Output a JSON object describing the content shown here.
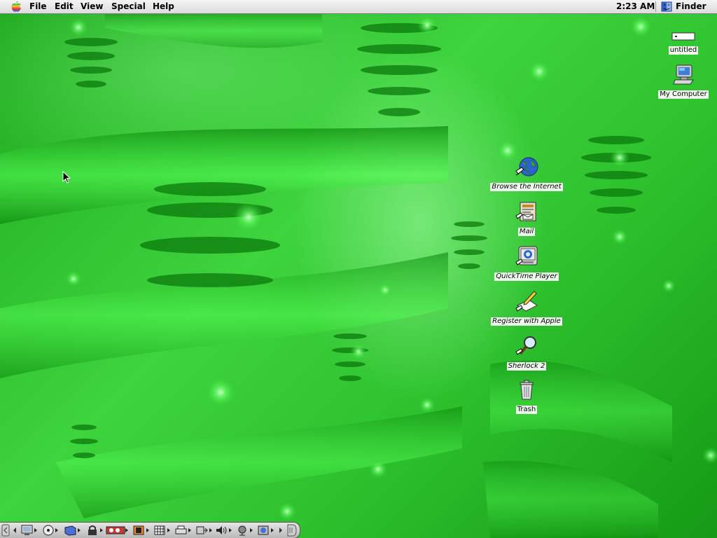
{
  "menubar": {
    "menus": [
      "File",
      "Edit",
      "View",
      "Special",
      "Help"
    ],
    "clock": "2:23 AM",
    "active_app": "Finder"
  },
  "desktop": {
    "icons": {
      "untitled": "untitled",
      "my_computer": "My Computer",
      "browse_internet": "Browse the Internet",
      "mail": "Mail",
      "quicktime": "QuickTime Player",
      "register": "Register with Apple",
      "sherlock": "Sherlock 2",
      "trash": "Trash"
    }
  },
  "colors": {
    "desktop_green": "#2fc42f",
    "menubar_bg": "#e8e8e8"
  }
}
